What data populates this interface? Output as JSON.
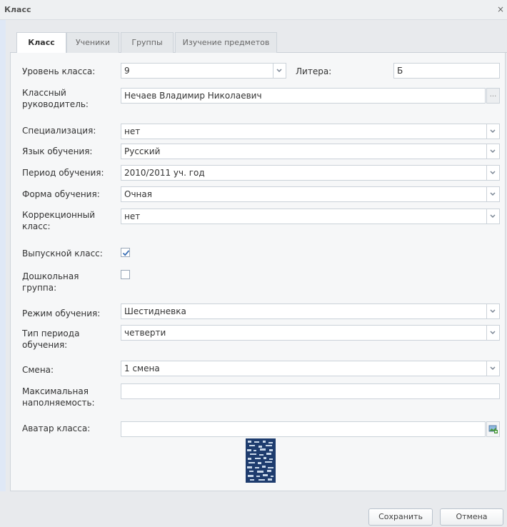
{
  "window": {
    "title": "Класс",
    "close": "×"
  },
  "tabs": [
    {
      "label": "Класс"
    },
    {
      "label": "Ученики"
    },
    {
      "label": "Группы"
    },
    {
      "label": "Изучение предметов"
    }
  ],
  "form": {
    "level_label": "Уровень класса:",
    "level_value": "9",
    "litera_label": "Литера:",
    "litera_value": "Б",
    "teacher_label": "Классный руководитель:",
    "teacher_value": "Нечаев Владимир Николаевич",
    "teacher_btn": "...",
    "specialization_label": "Специализация:",
    "specialization_value": "нет",
    "language_label": "Язык обучения:",
    "language_value": "Русский",
    "period_label": "Период обучения:",
    "period_value": "2010/2011 уч. год",
    "form_label": "Форма обучения:",
    "form_value": "Очная",
    "correction_label": "Коррекционный класс:",
    "correction_value": "нет",
    "graduate_label": "Выпускной класс:",
    "graduate_checked": true,
    "preschool_label": "Дошкольная группа:",
    "preschool_checked": false,
    "mode_label": "Режим обучения:",
    "mode_value": "Шестидневка",
    "period_type_label": "Тип периода обучения:",
    "period_type_value": "четверти",
    "shift_label": "Смена:",
    "shift_value": "1 смена",
    "max_label": "Максимальная наполняемость:",
    "max_value": "",
    "avatar_label": "Аватар класса:",
    "avatar_value": ""
  },
  "buttons": {
    "save": "Сохранить",
    "cancel": "Отмена"
  },
  "colors": {
    "panel": "#f6f7f8",
    "border": "#cbd2d9",
    "checkmark": "#3a6fb5",
    "image_icon": "#4a9a3a"
  }
}
